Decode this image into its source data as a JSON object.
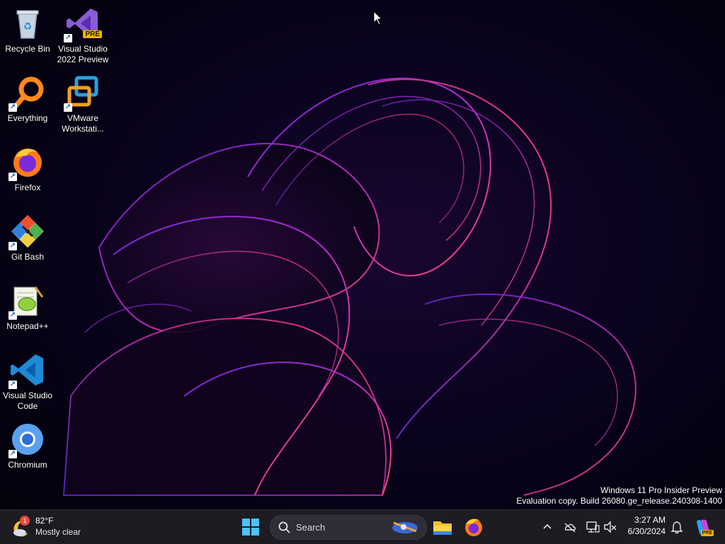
{
  "desktop": {
    "icons": [
      {
        "label": "Recycle Bin",
        "icon": "recycle-bin-icon"
      },
      {
        "label": "Visual Studio\n2022 Preview",
        "icon": "visual-studio-icon",
        "badge": "PRE"
      },
      {
        "label": "Everything",
        "icon": "everything-search-icon"
      },
      {
        "label": "VMware\nWorkstati...",
        "icon": "vmware-icon"
      },
      {
        "label": "Firefox",
        "icon": "firefox-icon"
      },
      {
        "label": "Git Bash",
        "icon": "git-bash-icon"
      },
      {
        "label": "Notepad++",
        "icon": "notepadpp-icon"
      },
      {
        "label": "Visual Studio\nCode",
        "icon": "vscode-icon"
      },
      {
        "label": "Chromium",
        "icon": "chromium-icon"
      }
    ],
    "watermark": {
      "line1": "Windows 11 Pro Insider Preview",
      "line2": "Evaluation copy. Build 26080.ge_release.240308-1400"
    }
  },
  "taskbar": {
    "weather": {
      "temp": "82°F",
      "condition": "Mostly clear",
      "alert_count": "1"
    },
    "search": {
      "placeholder": "Search"
    },
    "apps": [
      "start-icon",
      "file-explorer-icon",
      "firefox-icon"
    ],
    "tray": {
      "icons": [
        "chevron-up-icon",
        "onedrive-offline-icon",
        "network-icon",
        "volume-muted-icon",
        "notification-bell-icon",
        "copilot-icon"
      ],
      "copilot_badge": "PRE",
      "time": "3:27 AM",
      "date": "6/30/2024"
    }
  },
  "colors": {
    "taskbar": "#1c1c22",
    "accent": "#0078d4",
    "wallpaper_glow": "#b02ad8"
  }
}
